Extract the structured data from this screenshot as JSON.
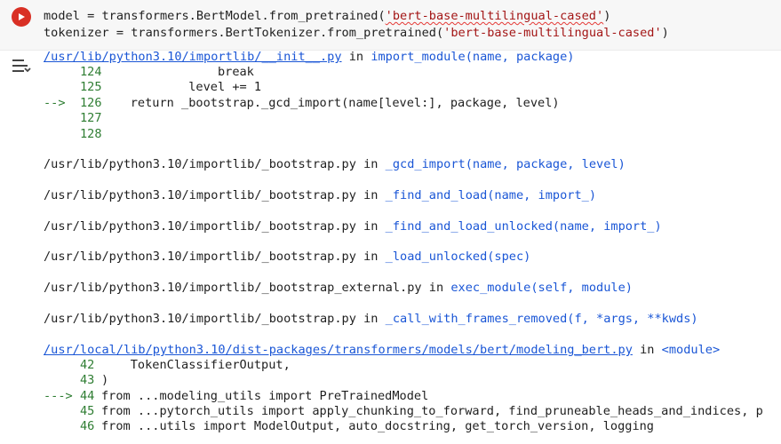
{
  "cell": {
    "run_button_icon": "play-icon",
    "run_button_color": "#d93025",
    "code_line_1": {
      "prefix": "model = transformers.BertModel.from_pretrained(",
      "string": "'bert-base-multilingual-cased'",
      "suffix": ")"
    },
    "code_line_2": {
      "prefix": "tokenizer = transformers.BertTokenizer.from_pretrained(",
      "string": "'bert-base-multilingual-cased'",
      "suffix": ")"
    }
  },
  "output": {
    "toggle_icon": "output-options-icon",
    "frame_1": {
      "path": "/usr/lib/python3.10/importlib/__init__.py",
      "in": "in",
      "func": "import_module(name, package)",
      "lines": [
        {
          "marker": "",
          "num": "124",
          "code": "                break"
        },
        {
          "marker": "",
          "num": "125",
          "code": "            level += 1"
        },
        {
          "marker": "-->",
          "num": "126",
          "code": "    return _bootstrap._gcd_import(name[level:], package, level)"
        },
        {
          "marker": "",
          "num": "127",
          "code": ""
        },
        {
          "marker": "",
          "num": "128",
          "code": ""
        }
      ]
    },
    "frames_plain": [
      {
        "path": "/usr/lib/python3.10/importlib/_bootstrap.py",
        "in": "in",
        "func": "_gcd_import(name, package, level)"
      },
      {
        "path": "/usr/lib/python3.10/importlib/_bootstrap.py",
        "in": "in",
        "func": "_find_and_load(name, import_)"
      },
      {
        "path": "/usr/lib/python3.10/importlib/_bootstrap.py",
        "in": "in",
        "func": "_find_and_load_unlocked(name, import_)"
      },
      {
        "path": "/usr/lib/python3.10/importlib/_bootstrap.py",
        "in": "in",
        "func": "_load_unlocked(spec)"
      },
      {
        "path": "/usr/lib/python3.10/importlib/_bootstrap_external.py",
        "in": "in",
        "func": "exec_module(self, module)"
      },
      {
        "path": "/usr/lib/python3.10/importlib/_bootstrap.py",
        "in": "in",
        "func": "_call_with_frames_removed(f, *args, **kwds)"
      }
    ],
    "frame_last": {
      "path": "/usr/local/lib/python3.10/dist-packages/transformers/models/bert/modeling_bert.py",
      "in": "in",
      "func": "<module>",
      "lines": [
        {
          "marker": "",
          "num": "42",
          "code": "    TokenClassifierOutput,"
        },
        {
          "marker": "",
          "num": "43",
          "code": ")"
        },
        {
          "marker": "--->",
          "num": "44",
          "code": "from ...modeling_utils import PreTrainedModel"
        },
        {
          "marker": "",
          "num": "45",
          "code": "from ...pytorch_utils import apply_chunking_to_forward, find_pruneable_heads_and_indices, p"
        },
        {
          "marker": "",
          "num": "46",
          "code": "from ...utils import ModelOutput, auto_docstring, get_torch_version, logging"
        }
      ]
    }
  }
}
